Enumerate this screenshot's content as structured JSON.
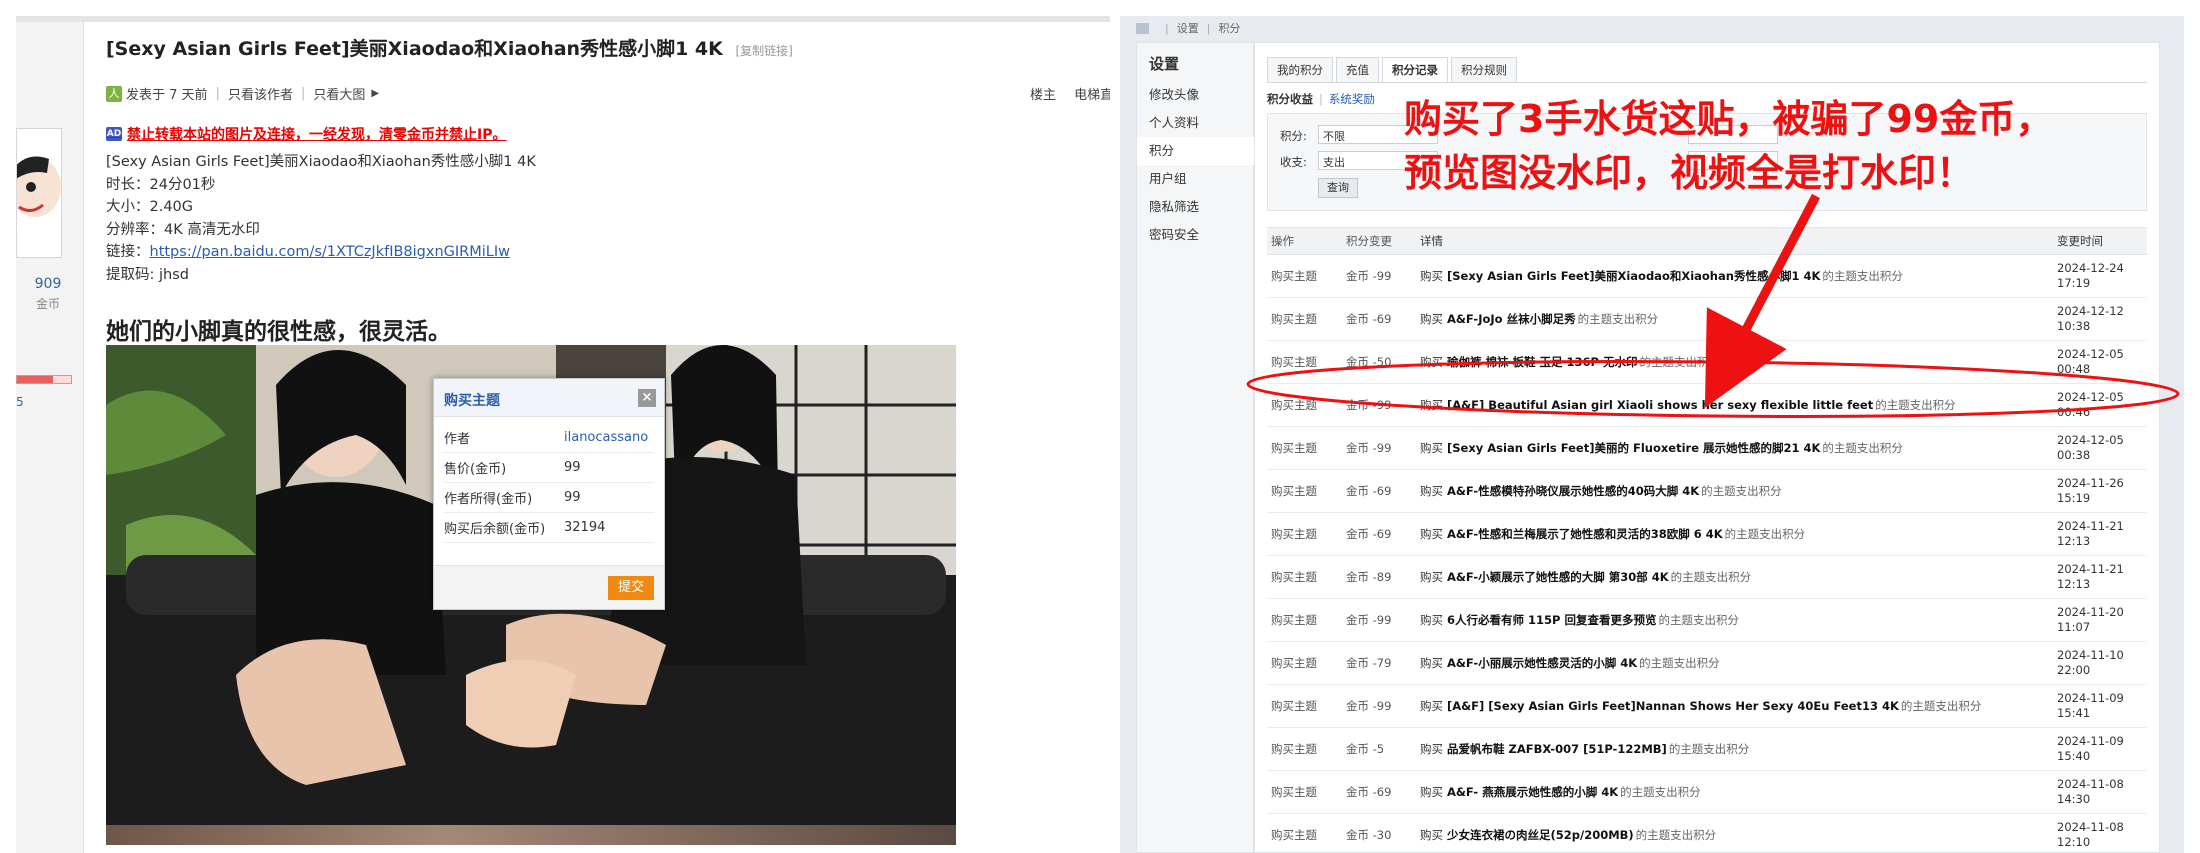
{
  "thread": {
    "title": "[Sexy Asian Girls Feet]美丽Xiaodao和Xiaohan秀性感小脚1 4K",
    "copy_link": "[复制链接]",
    "posted": "发表于 7 天前",
    "only_author": "只看该作者",
    "only_big_image": "只看大图",
    "floor_owner": "楼主",
    "elevator": "电梯直",
    "warning": "禁止转载本站的图片及连接，一经发现，清零金币并禁止IP。",
    "body_lines": [
      "[Sexy Asian Girls Feet]美丽Xiaodao和Xiaohan秀性感小脚1 4K",
      "时长：24分01秒",
      "大小：2.40G",
      "分辨率：4K 高清无水印"
    ],
    "link_label": "链接：",
    "link_url": "https://pan.baidu.com/s/1XTCzJkfIB8igxnGIRMiLIw",
    "code_line": "提取码: jhsd",
    "heading": "她们的小脚真的很性感，很灵活。",
    "user_stat_value": "909",
    "user_stat_label": "金币",
    "score_fragment": "5"
  },
  "buy_dialog": {
    "title": "购买主题",
    "close": "×",
    "rows": [
      {
        "k": "作者",
        "v": "ilanocassano"
      },
      {
        "k": "售价(金币)",
        "v": "99"
      },
      {
        "k": "作者所得(金币)",
        "v": "99"
      },
      {
        "k": "购买后余额(金币)",
        "v": "32194"
      }
    ],
    "submit": "提交"
  },
  "credits": {
    "breadcrumb": [
      "设置",
      "积分"
    ],
    "sidebar_title": "设置",
    "sidebar_items": [
      "修改头像",
      "个人资料",
      "积分",
      "用户组",
      "隐私筛选",
      "密码安全"
    ],
    "active_sidebar_index": 2,
    "tabs": [
      "我的积分",
      "充值",
      "积分记录",
      "积分规则"
    ],
    "active_tab_index": 2,
    "subtab_on": "积分收益",
    "subtab_off": "系统奖励",
    "filter": {
      "credit_label": "积分:",
      "credit_value": "不限",
      "inout_label": "收支:",
      "inout_value": "支出",
      "query_button": "查询"
    },
    "headers": [
      "操作",
      "积分变更",
      "详情",
      "变更时间"
    ],
    "rows": [
      {
        "op": "购买主题",
        "change": "金币 -99",
        "pre": "购买",
        "title": "[Sexy Asian Girls Feet]美丽Xiaodao和Xiaohan秀性感小脚1 4K",
        "tail": "的主题支出积分",
        "date": "2024-12-24",
        "time": "17:19"
      },
      {
        "op": "购买主题",
        "change": "金币 -69",
        "pre": "购买",
        "title": "A&F-JoJo 丝袜小脚足秀",
        "tail": "的主题支出积分",
        "date": "2024-12-12",
        "time": "10:38"
      },
      {
        "op": "购买主题",
        "change": "金币 -50",
        "pre": "购买",
        "title": "瑜伽裤 棉袜 板鞋 玉足 136P 无水印",
        "tail": "的主题支出积分",
        "date": "2024-12-05",
        "time": "00:48"
      },
      {
        "op": "购买主题",
        "change": "金币 -99",
        "pre": "购买",
        "title": "[A&F] Beautiful Asian girl Xiaoli shows her sexy flexible little feet",
        "tail": "的主题支出积分",
        "date": "2024-12-05",
        "time": "00:46"
      },
      {
        "op": "购买主题",
        "change": "金币 -99",
        "pre": "购买",
        "title": "[Sexy Asian Girls Feet]美丽的 Fluoxetire 展示她性感的脚21 4K",
        "tail": "的主题支出积分",
        "date": "2024-12-05",
        "time": "00:38"
      },
      {
        "op": "购买主题",
        "change": "金币 -69",
        "pre": "购买",
        "title": "A&F-性感模特孙晓仪展示她性感的40码大脚 4K",
        "tail": "的主题支出积分",
        "date": "2024-11-26",
        "time": "15:19"
      },
      {
        "op": "购买主题",
        "change": "金币 -69",
        "pre": "购买",
        "title": "A&F-性感和兰梅展示了她性感和灵活的38欧脚 6 4K",
        "tail": "的主题支出积分",
        "date": "2024-11-21",
        "time": "12:13"
      },
      {
        "op": "购买主题",
        "change": "金币 -89",
        "pre": "购买",
        "title": "A&F-小颖展示了她性感的大脚 第30部 4K",
        "tail": "的主题支出积分",
        "date": "2024-11-21",
        "time": "12:13"
      },
      {
        "op": "购买主题",
        "change": "金币 -99",
        "pre": "购买",
        "title": "6人行必看有师 115P 回复查看更多预览",
        "tail": "的主题支出积分",
        "date": "2024-11-20",
        "time": "11:07"
      },
      {
        "op": "购买主题",
        "change": "金币 -79",
        "pre": "购买",
        "title": "A&F-小丽展示她性感灵活的小脚 4K",
        "tail": "的主题支出积分",
        "date": "2024-11-10",
        "time": "22:00"
      },
      {
        "op": "购买主题",
        "change": "金币 -99",
        "pre": "购买",
        "title": "[A&F] [Sexy Asian Girls Feet]Nannan Shows Her Sexy 40Eu Feet13 4K",
        "tail": "的主题支出积分",
        "date": "2024-11-09",
        "time": "15:41"
      },
      {
        "op": "购买主题",
        "change": "金币 -5",
        "pre": "购买",
        "title": "品爱帆布鞋 ZAFBX-007 [51P-122MB]",
        "tail": "的主题支出积分",
        "date": "2024-11-09",
        "time": "15:40"
      },
      {
        "op": "购买主题",
        "change": "金币 -69",
        "pre": "购买",
        "title": "A&F- 燕燕展示她性感的小脚 4K",
        "tail": "的主题支出积分",
        "date": "2024-11-08",
        "time": "14:30"
      },
      {
        "op": "购买主题",
        "change": "金币 -30",
        "pre": "购买",
        "title": "少女连衣裙の肉丝足(52p/200MB)",
        "tail": "的主题支出积分",
        "date": "2024-11-08",
        "time": "12:10"
      }
    ]
  },
  "annotation": {
    "line1": "购买了3手水货这贴，被骗了99金币，",
    "line2": "预览图没水印，视频全是打水印！",
    "color": "#ee1111"
  },
  "colors": {
    "link": "#2a5db0",
    "warn": "#ee0000",
    "submit": "#f08a12"
  }
}
